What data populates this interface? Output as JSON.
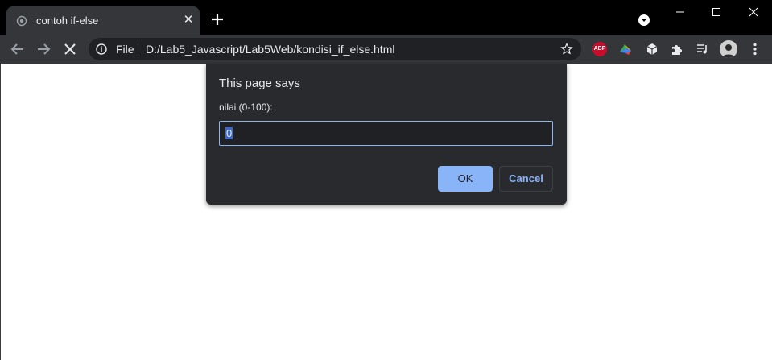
{
  "browser": {
    "tab": {
      "title": "contoh if-else",
      "favicon": "globe-icon"
    },
    "omnibox": {
      "scheme": "File",
      "url": "D:/Lab5_Javascript/Lab5Web/kondisi_if_else.html"
    },
    "extensions": [
      {
        "name": "adblock-plus",
        "label": "ABP",
        "color": "#c70d2c"
      },
      {
        "name": "colorful-extension"
      },
      {
        "name": "box-extension"
      },
      {
        "name": "extensions-puzzle"
      },
      {
        "name": "media-control"
      }
    ]
  },
  "dialog": {
    "title": "This page says",
    "message": "nilai (0-100):",
    "input_value": "0",
    "ok_label": "OK",
    "cancel_label": "Cancel"
  },
  "colors": {
    "titlebar": "#000000",
    "toolbar": "#35363a",
    "dialog_bg": "#292a2d",
    "accent": "#8ab4f8"
  }
}
